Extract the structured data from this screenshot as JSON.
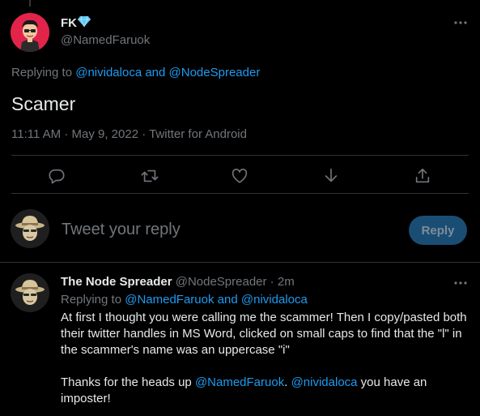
{
  "tweet": {
    "author_name": "FK",
    "author_badge": "gem-icon",
    "author_handle": "@NamedFaruok",
    "replying_prefix": "Replying to ",
    "replying_user1": "@nividaloca",
    "replying_and": " and ",
    "replying_user2": "@NodeSpreader",
    "text": "Scamer",
    "time": "11:11 AM · May 9, 2022 · ",
    "source": "Twitter for Android"
  },
  "actions": [
    "reply-icon",
    "retweet-icon",
    "like-icon",
    "downvote-icon",
    "share-icon"
  ],
  "compose": {
    "placeholder": "Tweet your reply",
    "button_label": "Reply"
  },
  "reply_tweet": {
    "name": "The Node Spreader",
    "handle": "@NodeSpreader",
    "time": " · 2m",
    "replying_prefix": "Replying to ",
    "replying_user1": "@NamedFaruok",
    "replying_and": " and ",
    "replying_user2": "@nividaloca",
    "paragraph1": "At first I thought you were calling me the scammer! Then I copy/pasted both their twitter handles in MS Word, clicked on small caps to find that the \"l\" in the scammer's name was an uppercase \"i\"",
    "p2_part1": "Thanks for the heads up ",
    "p2_mention1": "@NamedFaruok",
    "p2_part2": ". ",
    "p2_mention2": "@nividaloca",
    "p2_part3": " you have an imposter!"
  },
  "colors": {
    "accent": "#1d9bf0",
    "muted": "#71767b",
    "border": "#2f3336",
    "author_avatar_bg": "#e3244a"
  }
}
